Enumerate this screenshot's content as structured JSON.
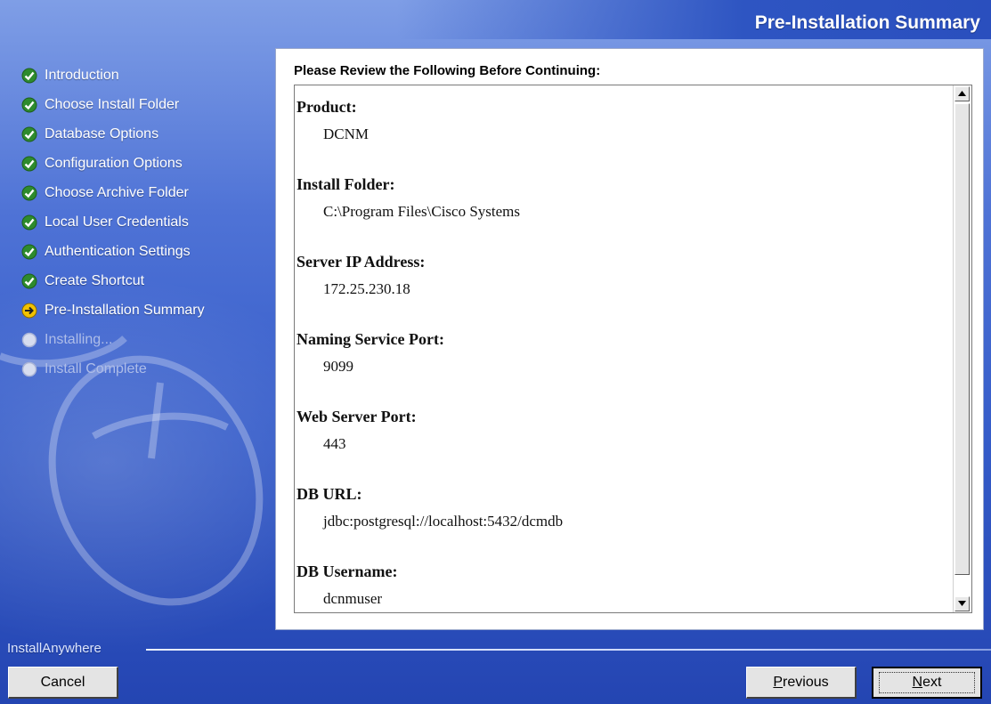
{
  "window": {
    "title": "Pre-Installation Summary"
  },
  "steps": [
    {
      "label": "Introduction",
      "state": "done"
    },
    {
      "label": "Choose Install Folder",
      "state": "done"
    },
    {
      "label": "Database Options",
      "state": "done"
    },
    {
      "label": "Configuration Options",
      "state": "done"
    },
    {
      "label": "Choose Archive Folder",
      "state": "done"
    },
    {
      "label": "Local User Credentials",
      "state": "done"
    },
    {
      "label": "Authentication Settings",
      "state": "done"
    },
    {
      "label": "Create Shortcut",
      "state": "done"
    },
    {
      "label": "Pre-Installation Summary",
      "state": "current"
    },
    {
      "label": "Installing...",
      "state": "pending"
    },
    {
      "label": "Install Complete",
      "state": "pending"
    }
  ],
  "summary": {
    "heading": "Please Review the Following Before Continuing:",
    "entries": [
      {
        "label": "Product:",
        "value": "DCNM"
      },
      {
        "label": "Install Folder:",
        "value": "C:\\Program Files\\Cisco Systems"
      },
      {
        "label": "Server IP Address:",
        "value": "172.25.230.18"
      },
      {
        "label": "Naming Service Port:",
        "value": "9099"
      },
      {
        "label": "Web Server Port:",
        "value": "443"
      },
      {
        "label": "DB URL:",
        "value": "jdbc:postgresql://localhost:5432/dcmdb"
      },
      {
        "label": "DB Username:",
        "value": "dcnmuser"
      }
    ]
  },
  "footer": {
    "brand": "InstallAnywhere",
    "cancel_label": "Cancel",
    "previous_label_first": "P",
    "previous_label_rest": "revious",
    "next_label_first": "N",
    "next_label_rest": "ext"
  },
  "icons": {
    "done": "check-circle-icon",
    "current": "arrow-circle-icon",
    "pending": "empty-circle-icon"
  },
  "colors": {
    "done": "#2e8b2e",
    "current": "#f2c200",
    "pending": "#c7cfe6"
  }
}
